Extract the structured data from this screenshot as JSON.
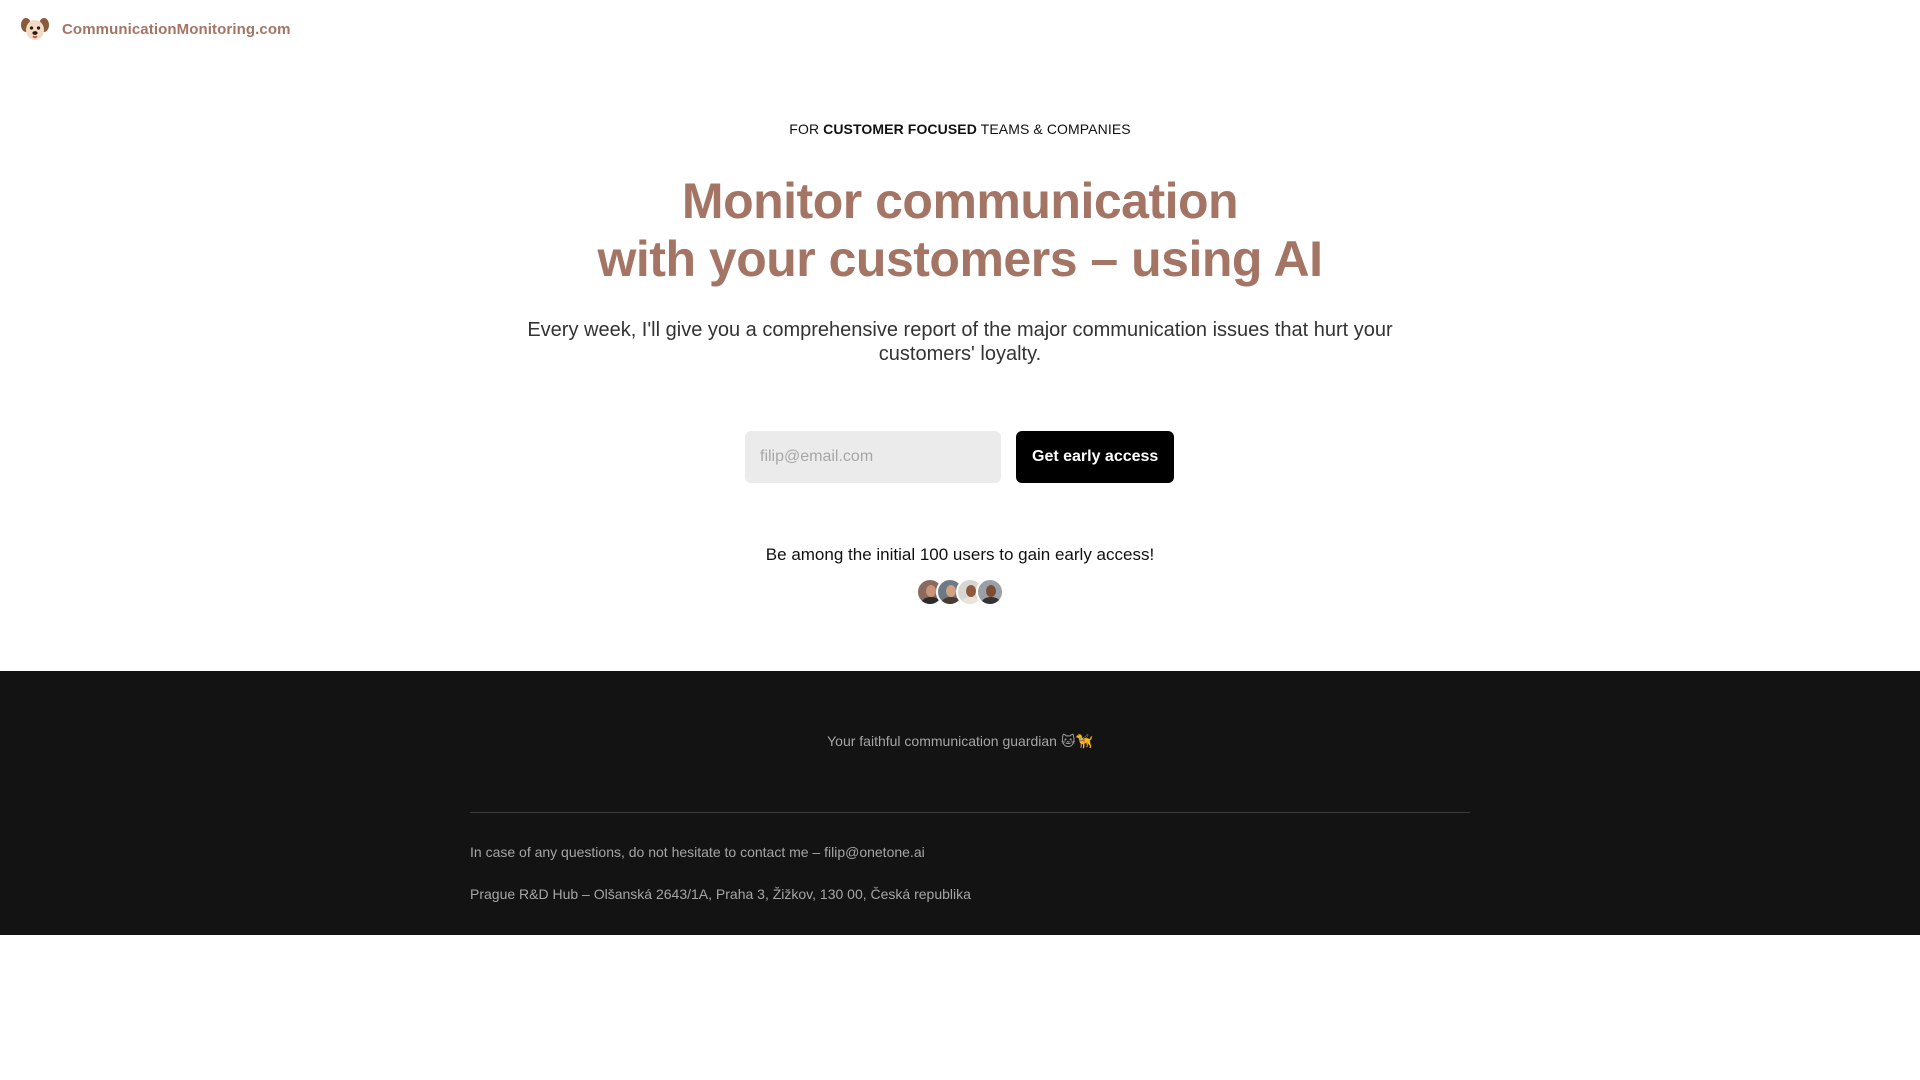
{
  "header": {
    "brand_name": "CommunicationMonitoring.com",
    "logo_icon": "dog-face-icon"
  },
  "hero": {
    "eyebrow_prefix": "FOR ",
    "eyebrow_bold": "CUSTOMER FOCUSED",
    "eyebrow_suffix": " TEAMS & COMPANIES",
    "headline_line1": "Monitor communication",
    "headline_line2": "with your customers – using AI",
    "subtitle": "Every week, I'll give you a comprehensive report of the major communication issues that hurt your customers' loyalty.",
    "email_placeholder": "filip@email.com",
    "email_value": "",
    "cta_label": "Get early access",
    "initial_users_note": "Be among the initial 100 users to gain early access!"
  },
  "avatars": [
    {
      "name": "user-avatar-1",
      "bg": "#8a6a5e",
      "face": "#c9957a",
      "body": "#2b2b2b"
    },
    {
      "name": "user-avatar-2",
      "bg": "#6b7a86",
      "face": "#d3a17f",
      "body": "#4a3a30"
    },
    {
      "name": "user-avatar-3",
      "bg": "#d9d5cf",
      "face": "#8c5a3c",
      "body": "#e9e4dc"
    },
    {
      "name": "user-avatar-4",
      "bg": "#9aa0a6",
      "face": "#7a4e36",
      "body": "#333333"
    }
  ],
  "footer": {
    "tagline": "Your faithful communication guardian 🐱🦮",
    "contact": "In case of any questions, do not hesitate to contact me – filip@onetone.ai",
    "address": "Prague R&D Hub – Olšanská 2643/1A, Praha 3, Žižkov, 130 00, Česká republika"
  },
  "colors": {
    "brand": "#a47464",
    "cta_bg": "#000000",
    "footer_bg": "#131313"
  }
}
